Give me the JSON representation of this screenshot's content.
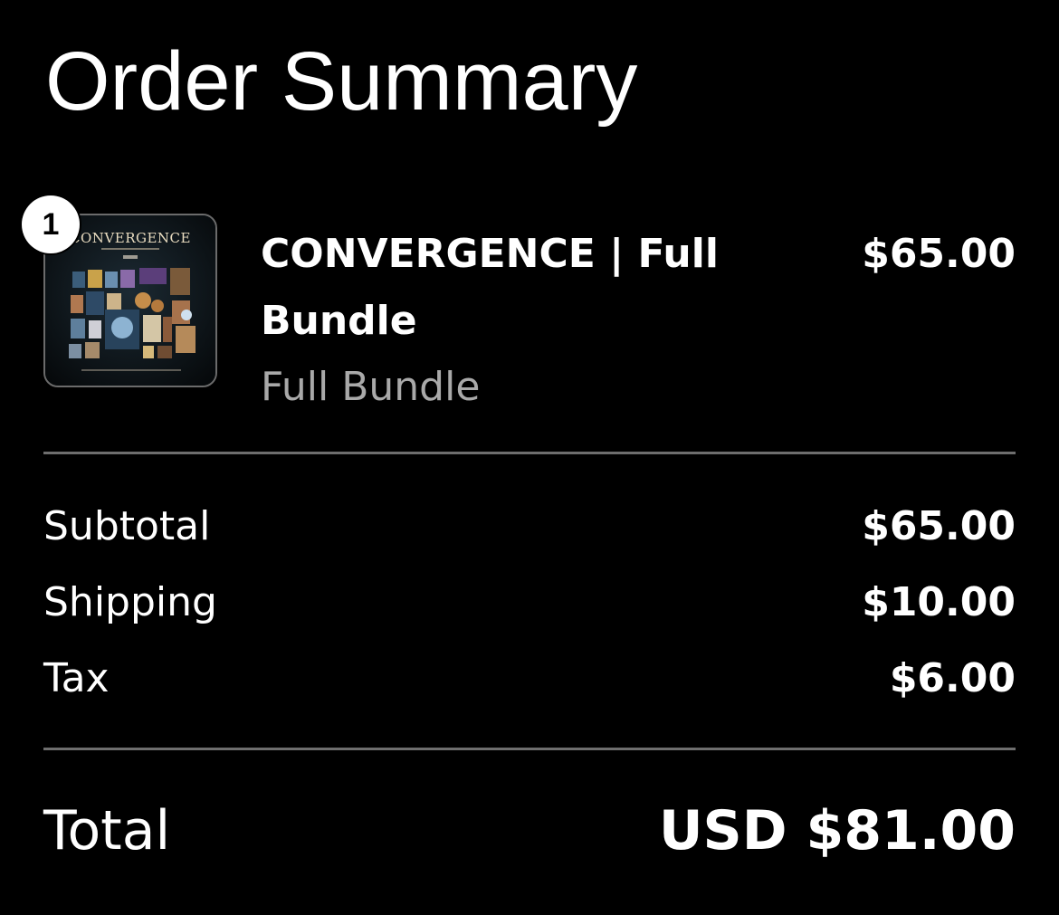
{
  "page": {
    "title": "Order Summary",
    "background_color": "#000000"
  },
  "line_items": [
    {
      "quantity": "1",
      "name": "CONVERGENCE | Full Bundle",
      "variant": "Full Bundle",
      "price": "$65.00",
      "thumbnail": {
        "icon": "product-image",
        "caption": "CONVERGENCE"
      }
    }
  ],
  "summary": {
    "subtotal": {
      "label": "Subtotal",
      "value": "$65.00"
    },
    "shipping": {
      "label": "Shipping",
      "value": "$10.00"
    },
    "tax": {
      "label": "Tax",
      "value": "$6.00"
    }
  },
  "total": {
    "label": "Total",
    "value": "USD $81.00"
  },
  "colors": {
    "text": "#ffffff",
    "muted_text": "#a9a9a9",
    "divider": "#6e6e6e"
  }
}
